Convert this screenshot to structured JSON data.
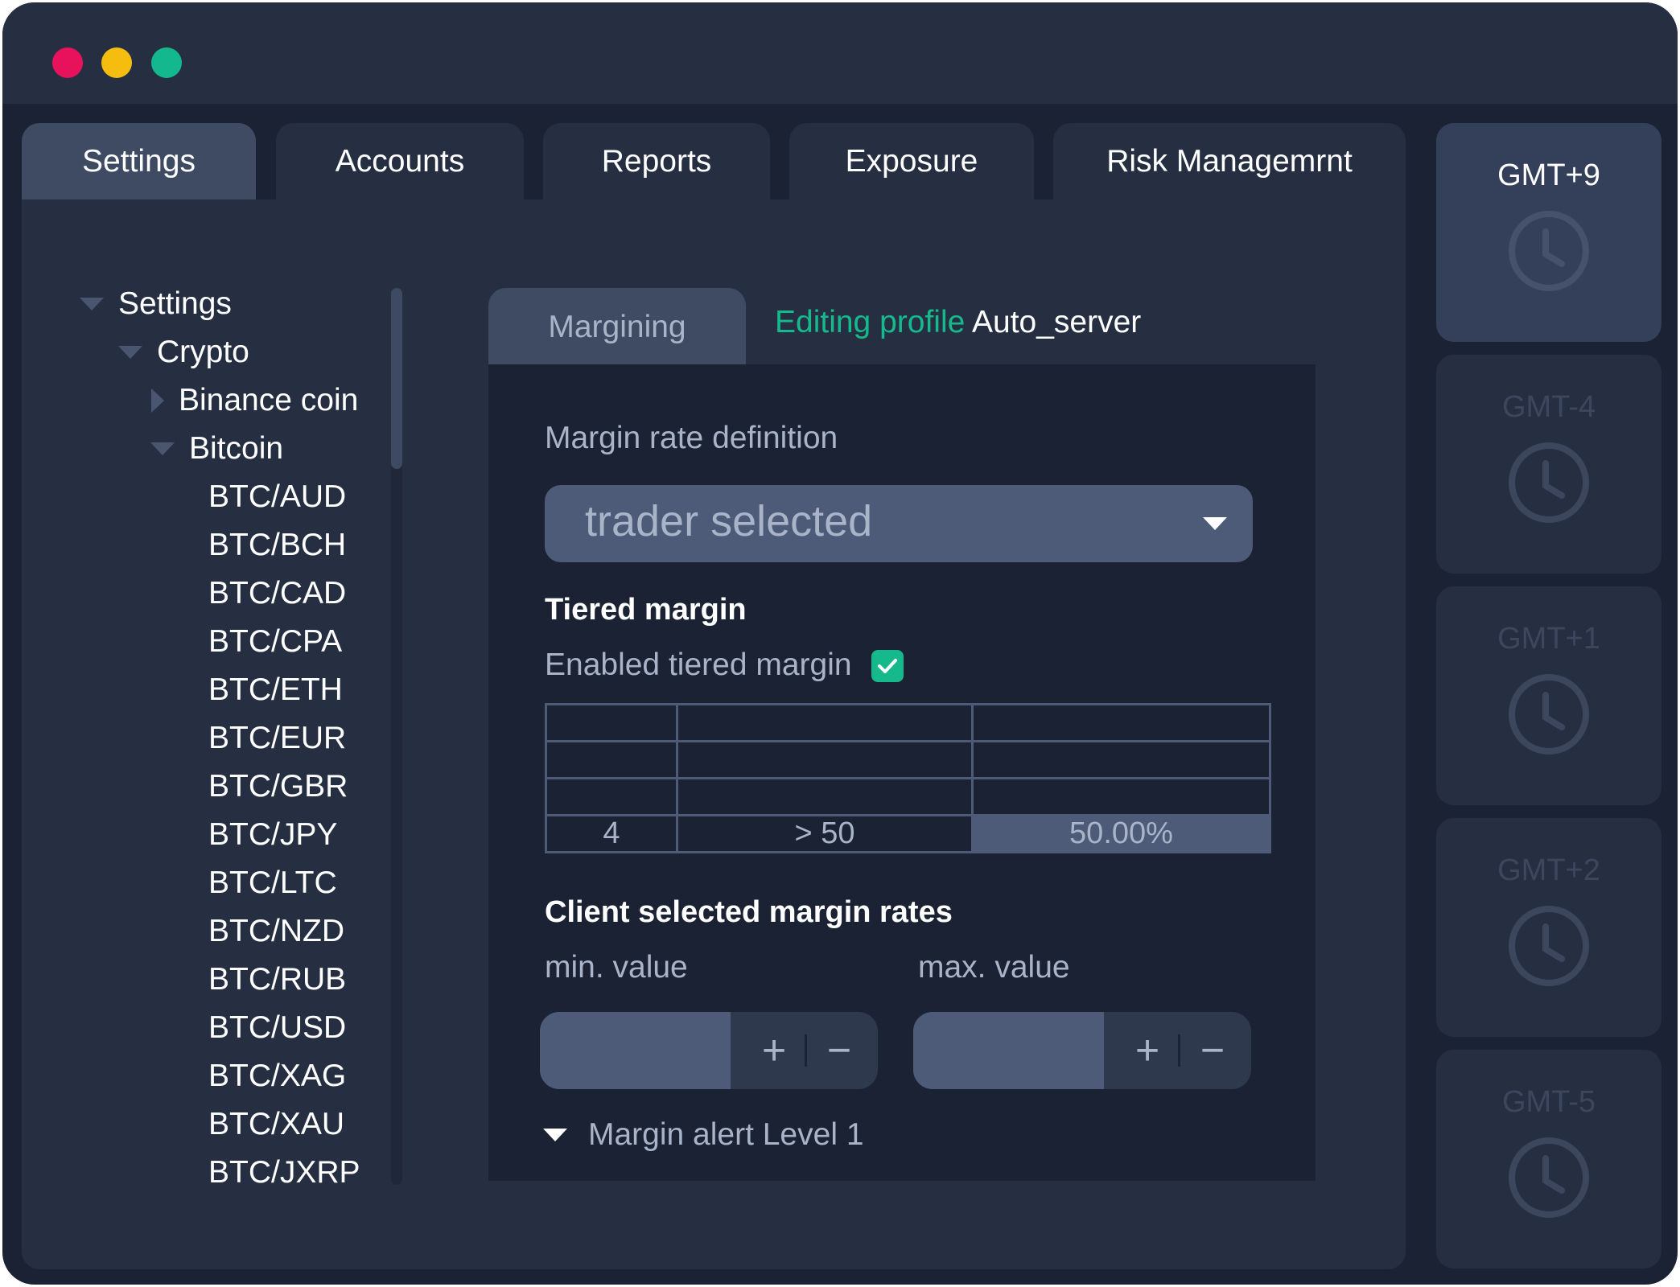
{
  "window": {
    "controls": [
      "close",
      "minimize",
      "maximize"
    ],
    "control_colors": {
      "close": "#e8125c",
      "minimize": "#f5bd0f",
      "maximize": "#14b88f"
    }
  },
  "tabs": [
    {
      "label": "Settings",
      "active": true
    },
    {
      "label": "Accounts",
      "active": false
    },
    {
      "label": "Reports",
      "active": false
    },
    {
      "label": "Exposure",
      "active": false
    },
    {
      "label": "Risk Managemrnt",
      "active": false
    }
  ],
  "tree": {
    "root": "Settings",
    "group": "Crypto",
    "collapsed_item": "Binance coin",
    "expanded_item": "Bitcoin",
    "pairs": [
      "BTC/AUD",
      "BTC/BCH",
      "BTC/CAD",
      "BTC/CPA",
      "BTC/ETH",
      "BTC/EUR",
      "BTC/GBR",
      "BTC/JPY",
      "BTC/LTC",
      "BTC/NZD",
      "BTC/RUB",
      "BTC/USD",
      "BTC/XAG",
      "BTC/XAU",
      "BTC/JXRP"
    ]
  },
  "panel": {
    "subtab": "Margining",
    "editing_prefix": "Editing profile",
    "profile_name": "Auto_server",
    "accent_color": "#16b98c",
    "margin_rate_label": "Margin rate definition",
    "margin_rate_value": "trader selected",
    "tiered_heading": "Tiered margin",
    "tiered_checkbox_label": "Enabled tiered margin",
    "tiered_enabled": true,
    "tier_table": [
      [
        "",
        "",
        ""
      ],
      [
        "",
        "",
        ""
      ],
      [
        "",
        "",
        ""
      ],
      [
        "4",
        "> 50",
        "50.00%"
      ]
    ],
    "client_rates_heading": "Client selected margin rates",
    "min_label": "min. value",
    "max_label": "max. value",
    "min_value": "",
    "max_value": "",
    "stepper_plus": "+",
    "stepper_minus": "−",
    "alert_label": "Margin alert Level 1"
  },
  "timezones": [
    {
      "label": "GMT+9",
      "active": true
    },
    {
      "label": "GMT-4",
      "active": false
    },
    {
      "label": "GMT+1",
      "active": false
    },
    {
      "label": "GMT+2",
      "active": false
    },
    {
      "label": "GMT-5",
      "active": false
    }
  ]
}
